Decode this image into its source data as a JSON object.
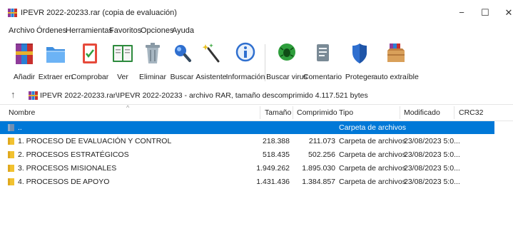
{
  "window": {
    "title": "IPEVR 2022-20233.rar (copia de evaluación)",
    "controls": {
      "minimize": "−",
      "maximize": "☐",
      "close": "✕"
    }
  },
  "menu": [
    "Archivo",
    "Órdenes",
    "Herramientas",
    "Favoritos",
    "Opciones",
    "Ayuda"
  ],
  "toolbar": [
    {
      "label": "Añadir",
      "icon": "add-books-icon"
    },
    {
      "label": "Extraer en",
      "icon": "extract-folder-icon"
    },
    {
      "label": "Comprobar",
      "icon": "test-checklist-icon"
    },
    {
      "label": "Ver",
      "icon": "view-book-icon"
    },
    {
      "label": "Eliminar",
      "icon": "trash-icon"
    },
    {
      "label": "Buscar",
      "icon": "magnifier-icon"
    },
    {
      "label": "Asistente",
      "icon": "wizard-wand-icon"
    },
    {
      "label": "Información",
      "icon": "info-icon"
    },
    {
      "label": "Buscar virus",
      "icon": "virus-scan-icon"
    },
    {
      "label": "Comentario",
      "icon": "comment-icon"
    },
    {
      "label": "Proteger",
      "icon": "shield-icon"
    },
    {
      "label": "auto extraíble",
      "icon": "sfx-box-icon"
    }
  ],
  "address": {
    "path": "IPEVR 2022-20233.rar\\IPEVR 2022-20233 - archivo RAR, tamaño descomprimido 4.117.521 bytes"
  },
  "columns": {
    "name": "Nombre",
    "size": "Tamaño",
    "packed": "Comprimido",
    "type": "Tipo",
    "modified": "Modificado",
    "crc": "CRC32"
  },
  "rows": [
    {
      "name": "..",
      "size": "",
      "packed": "",
      "type": "Carpeta de archivos",
      "modified": "",
      "selected": true
    },
    {
      "name": "1. PROCESO DE EVALUACIÓN Y CONTROL",
      "size": "218.388",
      "packed": "211.073",
      "type": "Carpeta de archivos",
      "modified": "23/08/2023 5:0...",
      "selected": false
    },
    {
      "name": "2. PROCESOS ESTRATÉGICOS",
      "size": "518.435",
      "packed": "502.256",
      "type": "Carpeta de archivos",
      "modified": "23/08/2023 5:0...",
      "selected": false
    },
    {
      "name": "3. PROCESOS MISIONALES",
      "size": "1.949.262",
      "packed": "1.895.030",
      "type": "Carpeta de archivos",
      "modified": "23/08/2023 5:0...",
      "selected": false
    },
    {
      "name": "4. PROCESOS DE APOYO",
      "size": "1.431.436",
      "packed": "1.384.857",
      "type": "Carpeta de archivos",
      "modified": "23/08/2023 5:0...",
      "selected": false
    }
  ],
  "colors": {
    "selection": "#0078d7",
    "folder": "#f2c230"
  }
}
